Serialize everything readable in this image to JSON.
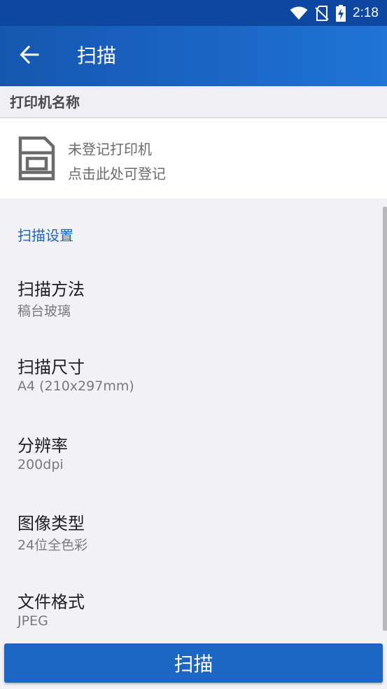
{
  "status_bar": {
    "time": "2:18",
    "icons": [
      "wifi-icon",
      "no-sim-icon",
      "battery-charging-icon"
    ]
  },
  "app_bar": {
    "title": "扫描",
    "back_icon": "arrow-left-icon"
  },
  "printer": {
    "header": "打印机名称",
    "line1": "未登记打印机",
    "line2": "点击此处可登记",
    "icon": "printer-icon"
  },
  "settings": {
    "section_title": "扫描设置",
    "items": [
      {
        "label": "扫描方法",
        "value": "稿台玻璃"
      },
      {
        "label": "扫描尺寸",
        "value": "A4 (210x297mm)"
      },
      {
        "label": "分辨率",
        "value": "200dpi"
      },
      {
        "label": "图像类型",
        "value": "24位全色彩"
      },
      {
        "label": "文件格式",
        "value": "JPEG"
      }
    ]
  },
  "scan_button": {
    "label": "扫描"
  },
  "colors": {
    "primary": "#1a66c2",
    "status_bar": "#0d47a1",
    "background": "#f1f1f6"
  }
}
